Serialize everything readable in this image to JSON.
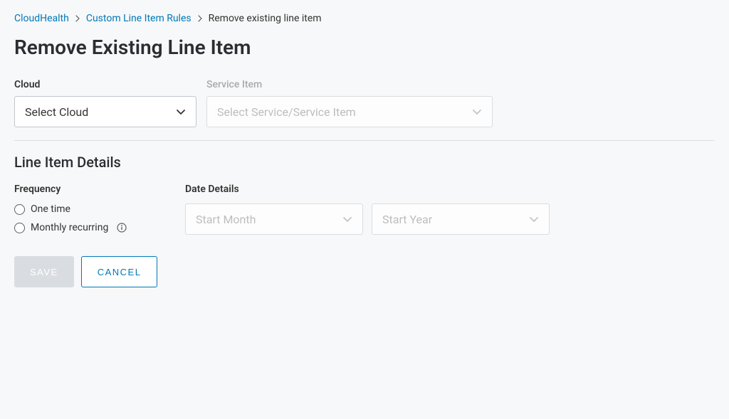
{
  "breadcrumb": {
    "root": "CloudHealth",
    "parent": "Custom Line Item Rules",
    "current": "Remove existing line item"
  },
  "page_title": "Remove Existing Line Item",
  "cloud": {
    "label": "Cloud",
    "placeholder": "Select Cloud"
  },
  "service_item": {
    "label": "Service Item",
    "placeholder": "Select Service/Service Item"
  },
  "section_title": "Line Item Details",
  "frequency": {
    "label": "Frequency",
    "options": {
      "one_time": "One time",
      "monthly": "Monthly recurring"
    }
  },
  "date_details": {
    "label": "Date Details",
    "start_month_placeholder": "Start Month",
    "start_year_placeholder": "Start Year"
  },
  "buttons": {
    "save": "Save",
    "cancel": "Cancel"
  }
}
